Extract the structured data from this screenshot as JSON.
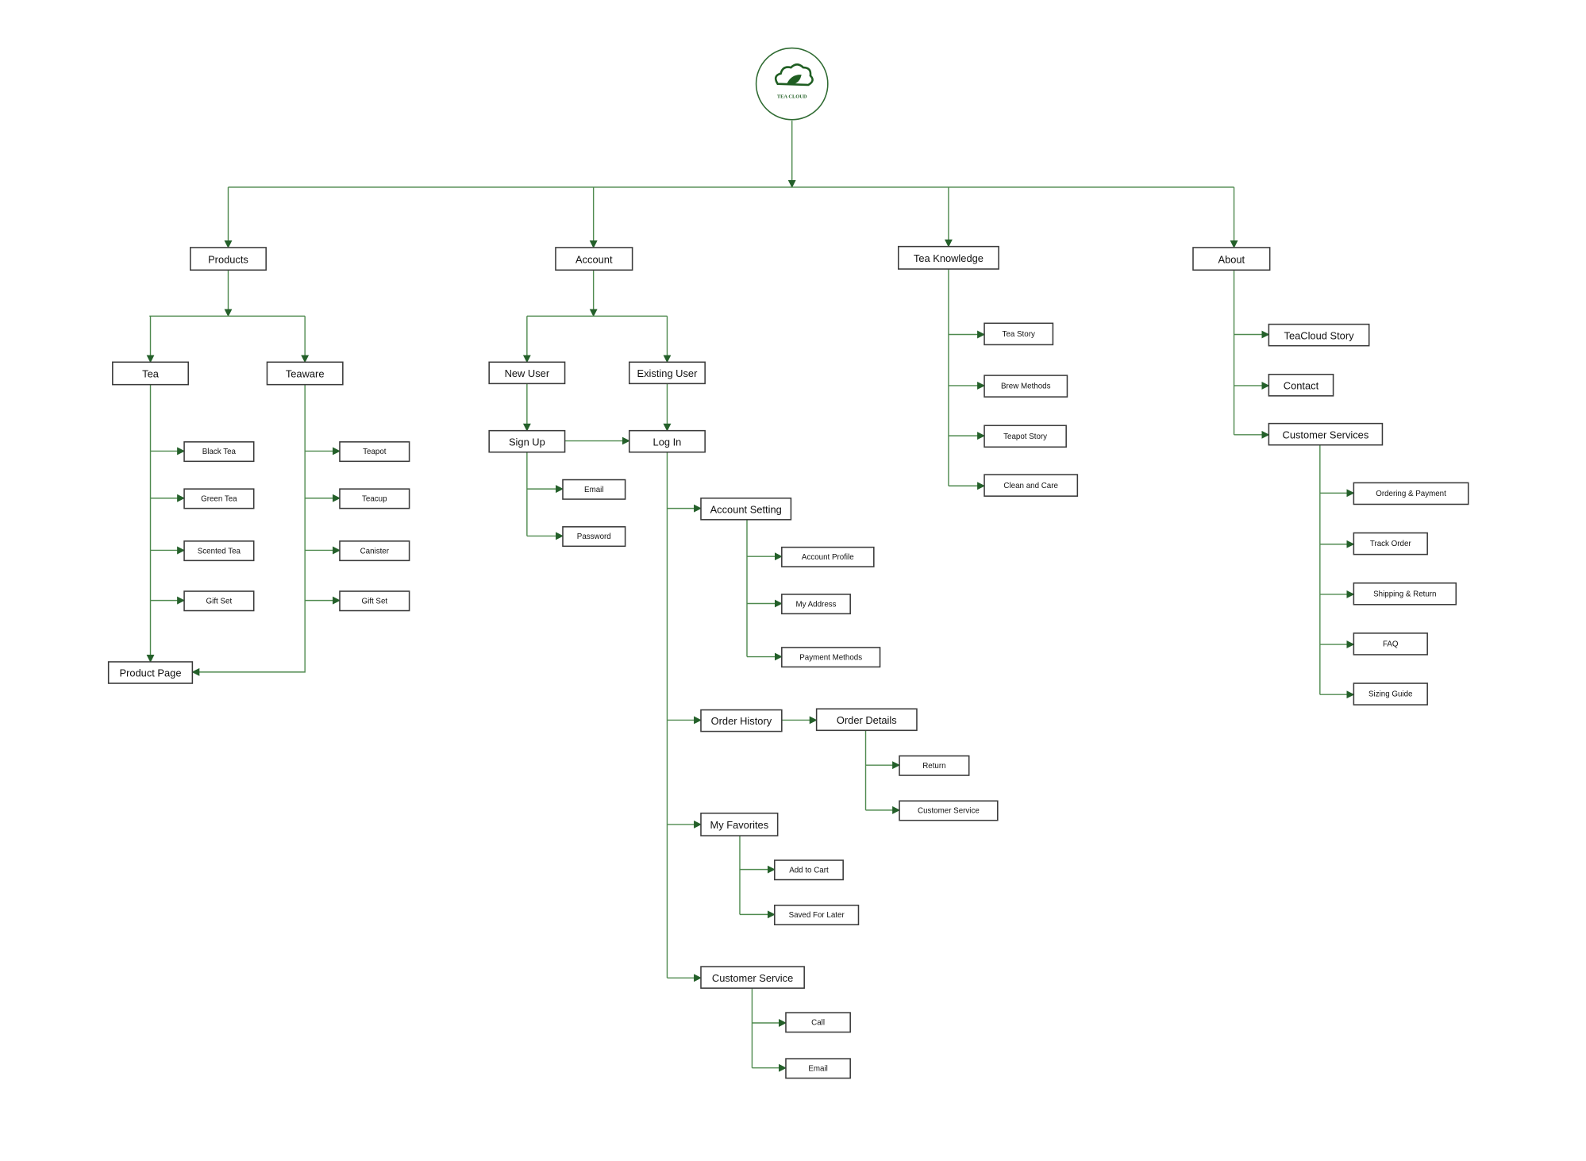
{
  "colors": {
    "connector": "#4f8a4f",
    "arrow": "#24602a",
    "box_border": "#3a3a3a",
    "logo": "#1f5e22"
  },
  "logo": {
    "text": "TEA CLOUD",
    "icon": "cloud-leaf-icon"
  },
  "nodes": {
    "products": "Products",
    "tea": "Tea",
    "black_tea": "Black Tea",
    "green_tea": "Green Tea",
    "scented_tea": "Scented Tea",
    "gift_set_tea": "Gift Set",
    "teaware": "Teaware",
    "teapot": "Teapot",
    "teacup": "Teacup",
    "canister": "Canister",
    "gift_set_ware": "Gift Set",
    "product_page": "Product Page",
    "account": "Account",
    "new_user": "New User",
    "existing_user": "Existing User",
    "sign_up": "Sign Up",
    "log_in": "Log In",
    "email_signup": "Email",
    "password": "Password",
    "account_setting": "Account Setting",
    "account_profile": "Account Profile",
    "my_address": "My Address",
    "payment_methods": "Payment Methods",
    "order_history": "Order History",
    "order_details": "Order Details",
    "return": "Return",
    "order_customer_service": "Customer Service",
    "my_favorites": "My Favorites",
    "add_to_cart": "Add to Cart",
    "saved_for_later": "Saved For Later",
    "customer_service": "Customer Service",
    "call": "Call",
    "email_cs": "Email",
    "tea_knowledge": "Tea Knowledge",
    "tea_story": "Tea Story",
    "brew_methods": "Brew Methods",
    "teapot_story": "Teapot Story",
    "clean_and_care": "Clean and Care",
    "about": "About",
    "teacloud_story": "TeaCloud Story",
    "contact": "Contact",
    "customer_services": "Customer Services",
    "ordering_payment": "Ordering & Payment",
    "track_order": "Track Order",
    "shipping_return": "Shipping & Return",
    "faq": "FAQ",
    "sizing_guide": "Sizing Guide"
  }
}
